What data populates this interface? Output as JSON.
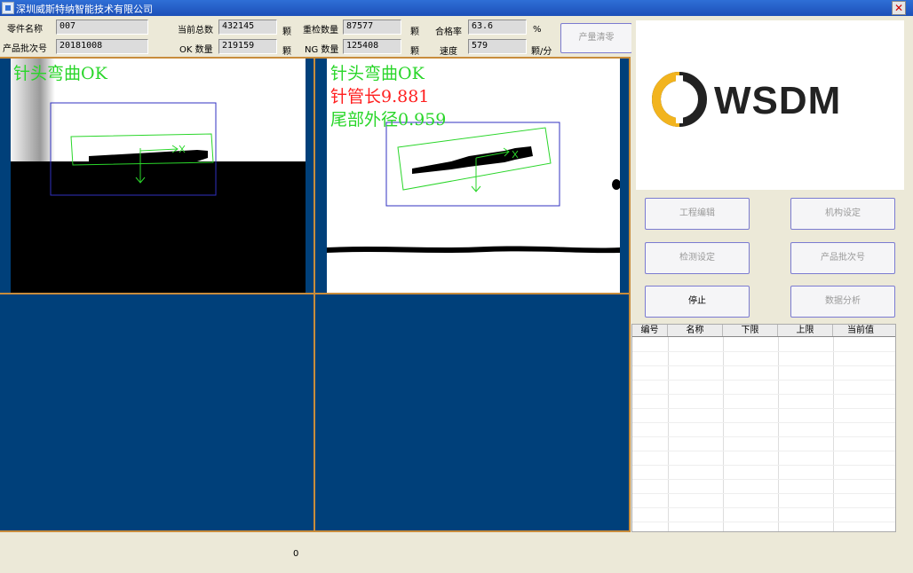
{
  "window": {
    "title": "深圳威斯特纳智能技术有限公司",
    "close_symbol": "✕"
  },
  "info": {
    "part_name_label": "零件名称",
    "part_name_value": "007",
    "batch_label": "产品批次号",
    "batch_value": "20181008",
    "total_label": "当前总数",
    "total_value": "432145",
    "ok_label": "OK 数量",
    "ok_value": "219159",
    "recheck_label": "重检数量",
    "recheck_value": "87577",
    "ng_label": "NG 数量",
    "ng_value": "125408",
    "pass_rate_label": "合格率",
    "pass_rate_value": "63.6",
    "speed_label": "速度",
    "speed_value": "579",
    "unit_count": "颗",
    "unit_percent": "%",
    "unit_speed": "颗/分"
  },
  "buttons": {
    "reset_output": "产量清零",
    "project_edit": "工程编辑",
    "mechanism_setup": "机构设定",
    "detect_setup": "检测设定",
    "batch_number": "产品批次号",
    "stop": "停止",
    "data_analysis": "数据分析"
  },
  "camera1": {
    "overlay_line1": "针头弯曲OK"
  },
  "camera2": {
    "overlay_line1": "针头弯曲OK",
    "overlay_line2": "针管长9.881",
    "overlay_line3": "尾部外径0.959"
  },
  "logo": {
    "text": "WSDM"
  },
  "table": {
    "headers": [
      "编号",
      "名称",
      "下限",
      "上限",
      "当前值"
    ]
  },
  "status": {
    "counter": "0"
  },
  "colors": {
    "overlay_green": "#2ad62a",
    "overlay_red": "#ff2020",
    "view_bg": "#00407a",
    "logo_yellow": "#f2b41e"
  }
}
